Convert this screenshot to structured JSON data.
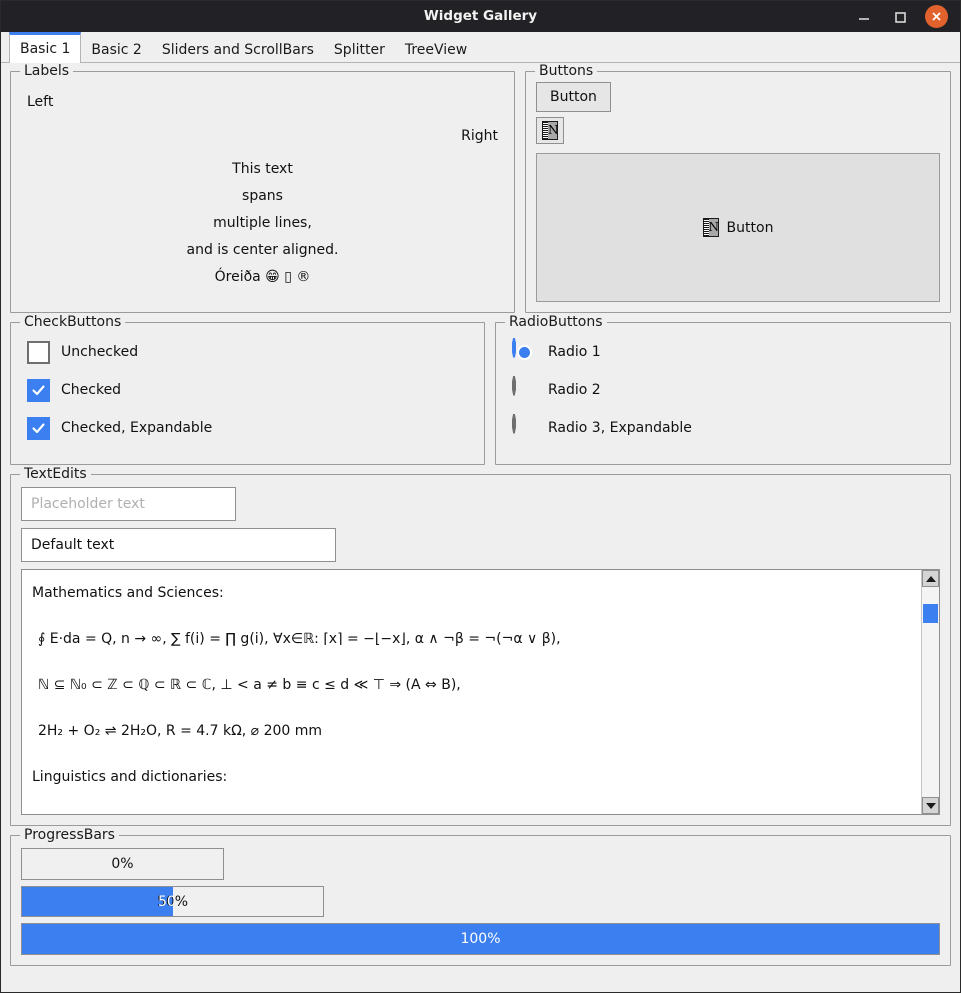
{
  "window": {
    "title": "Widget Gallery",
    "controls": {
      "minimize": "minimize",
      "maximize": "maximize",
      "close": "close"
    }
  },
  "tabs": [
    {
      "label": "Basic 1",
      "active": true
    },
    {
      "label": "Basic 2",
      "active": false
    },
    {
      "label": "Sliders and ScrollBars",
      "active": false
    },
    {
      "label": "Splitter",
      "active": false
    },
    {
      "label": "TreeView",
      "active": false
    }
  ],
  "labels_group": {
    "title": "Labels",
    "left": "Left",
    "right": "Right",
    "center_lines": [
      "This text",
      "spans",
      "multiple lines,",
      "and is center aligned.",
      "Óreiða 😁 ▯ ®"
    ]
  },
  "buttons_group": {
    "title": "Buttons",
    "push_button": "Button",
    "icon_button_glyph": "N",
    "icon_name": "missing-image-icon",
    "flat_button": "Button"
  },
  "checkbuttons_group": {
    "title": "CheckButtons",
    "items": [
      {
        "label": "Unchecked",
        "checked": false
      },
      {
        "label": "Checked",
        "checked": true
      },
      {
        "label": "Checked, Expandable",
        "checked": true
      }
    ]
  },
  "radiobuttons_group": {
    "title": "RadioButtons",
    "items": [
      {
        "label": "Radio 1",
        "selected": true
      },
      {
        "label": "Radio 2",
        "selected": false
      },
      {
        "label": "Radio 3, Expandable",
        "selected": false
      }
    ]
  },
  "textedits_group": {
    "title": "TextEdits",
    "placeholder_field": {
      "value": "",
      "placeholder": "Placeholder text"
    },
    "default_field": {
      "value": "Default text"
    },
    "textarea": {
      "lines": [
        "Mathematics and Sciences:",
        "∮ E·da = Q,  n → ∞, ∑ f(i) = ∏ g(i), ∀x∈ℝ: ⌈x⌉ = −⌊−x⌋, α ∧ ¬β = ¬(¬α ∨ β),",
        "ℕ ⊆ ℕ₀ ⊂ ℤ ⊂ ℚ ⊂ ℝ ⊂ ℂ, ⊥ < a ≠ b ≡ c ≤ d ≪ ⊤ ⇒ (A ⇔ B),",
        "2H₂ + O₂ ⇌ 2H₂O, R = 4.7 kΩ, ⌀ 200 mm",
        "Linguistics and dictionaries:"
      ],
      "scrollbar": {
        "up": "▲",
        "down": "▼",
        "thumb_position": "near-top"
      }
    }
  },
  "progressbars_group": {
    "title": "ProgressBars",
    "bars": [
      {
        "label": "0%",
        "value": 0
      },
      {
        "label": "50%",
        "value": 50
      },
      {
        "label": "100%",
        "value": 100
      }
    ]
  },
  "colors": {
    "accent": "#3b7ff0",
    "titlebar": "#222226",
    "close_button": "#e1622c",
    "panel": "#efefef",
    "frame": "#e0e0e0"
  }
}
